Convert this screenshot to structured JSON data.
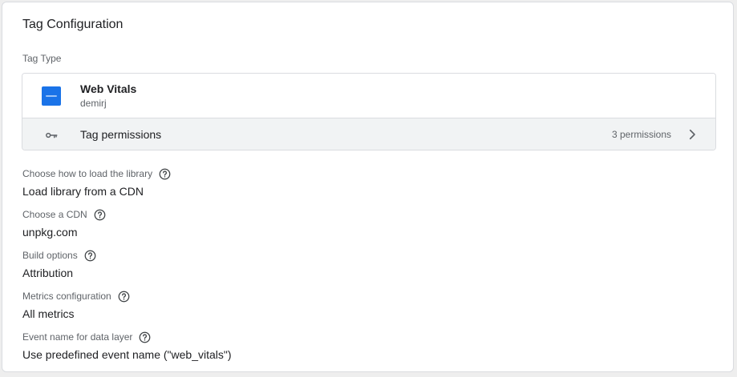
{
  "card": {
    "title": "Tag Configuration",
    "section_label": "Tag Type"
  },
  "tag_type": {
    "name": "Web Vitals",
    "author": "demirj",
    "logo_color": "#1a73e8",
    "permissions_label": "Tag permissions",
    "permissions_count": "3 permissions"
  },
  "fields": [
    {
      "label": "Choose how to load the library",
      "value": "Load library from a CDN"
    },
    {
      "label": "Choose a CDN",
      "value": "unpkg.com"
    },
    {
      "label": "Build options",
      "value": "Attribution"
    },
    {
      "label": "Metrics configuration",
      "value": "All metrics"
    },
    {
      "label": "Event name for data layer",
      "value": "Use predefined event name (\"web_vitals\")"
    }
  ],
  "icons": {
    "permissions": "key-icon",
    "open": "chevron-right-icon",
    "help": "help-circle-icon"
  },
  "colors": {
    "text_primary": "#202124",
    "text_secondary": "#5f6368",
    "border": "#dadce0",
    "row_bg": "#f1f3f4"
  }
}
